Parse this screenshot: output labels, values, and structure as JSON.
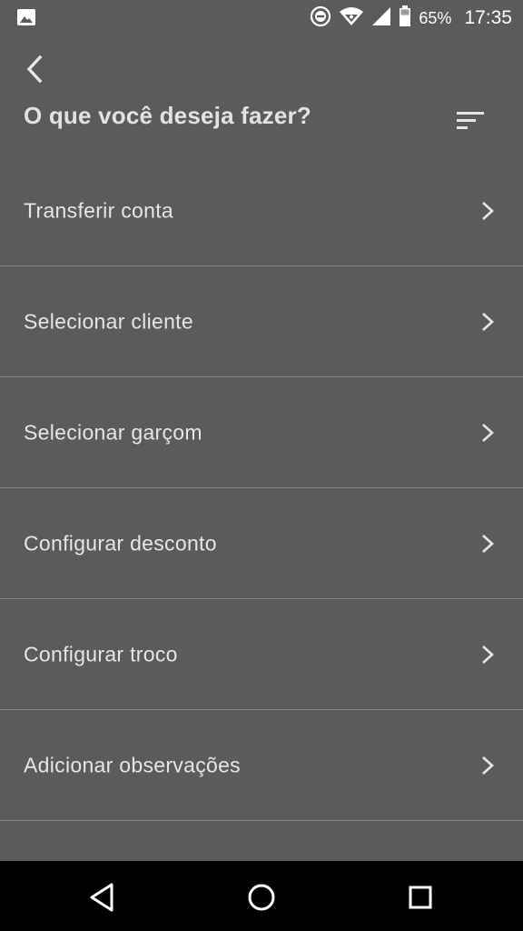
{
  "status_bar": {
    "battery_percent": "65%",
    "time": "17:35",
    "icons": [
      "image-icon",
      "do-not-disturb-icon",
      "wifi-icon",
      "signal-icon",
      "battery-icon"
    ]
  },
  "header": {
    "title": "O que você deseja fazer?",
    "back_icon": "chevron-left-icon",
    "sort_icon": "sort-icon"
  },
  "menu": {
    "items": [
      {
        "label": "Transferir conta"
      },
      {
        "label": "Selecionar cliente"
      },
      {
        "label": "Selecionar garçom"
      },
      {
        "label": "Configurar desconto"
      },
      {
        "label": "Configurar troco"
      },
      {
        "label": "Adicionar observações"
      }
    ]
  },
  "nav_bar": {
    "icons": [
      "nav-back-icon",
      "nav-home-icon",
      "nav-recent-apps-icon"
    ]
  },
  "colors": {
    "background": "#5b5b5b",
    "text": "#e6e6e6",
    "divider": "#888888",
    "nav_bar": "#000000"
  }
}
